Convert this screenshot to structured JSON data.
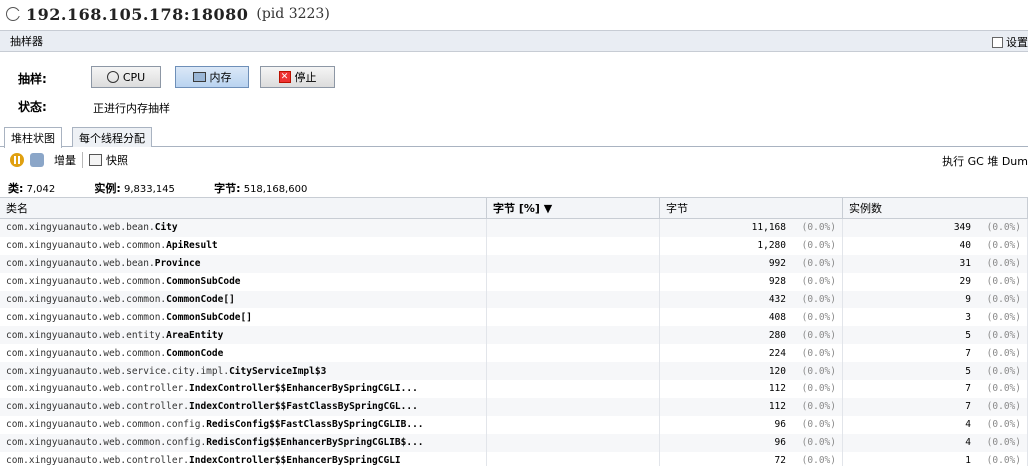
{
  "title": {
    "host": "192.168.105.178:18080",
    "pid": "(pid 3223)"
  },
  "sampler": {
    "label": "抽样器",
    "settings_label": "设置"
  },
  "sampling": {
    "label": "抽样:",
    "cpu_button": "CPU",
    "memory_button": "内存",
    "stop_button": "停止",
    "status_label": "状态:",
    "status_value": "正进行内存抽样"
  },
  "tabs": [
    {
      "label": "堆柱状图"
    },
    {
      "label": "每个线程分配"
    }
  ],
  "toolbar": {
    "delta_label": "增量",
    "snapshot_label": "快照",
    "right_text": "执行 GC  堆 Dum"
  },
  "stats": {
    "classes_label": "类:",
    "classes_value": "7,042",
    "instances_label": "实例:",
    "instances_value": "9,833,145",
    "bytes_label": "字节:",
    "bytes_value": "518,168,600"
  },
  "table": {
    "headers": {
      "name": "类名",
      "bytes_pct": "字节 [%] ▼",
      "bytes": "字节",
      "instances": "实例数"
    },
    "rows": [
      {
        "pkg": "com.xingyuanauto.web.bean.",
        "cls": "City",
        "bytes": "11,168",
        "bytes_pct": "(0.0%)",
        "instances": "349",
        "inst_pct": "(0.0%)"
      },
      {
        "pkg": "com.xingyuanauto.web.common.",
        "cls": "ApiResult",
        "bytes": "1,280",
        "bytes_pct": "(0.0%)",
        "instances": "40",
        "inst_pct": "(0.0%)"
      },
      {
        "pkg": "com.xingyuanauto.web.bean.",
        "cls": "Province",
        "bytes": "992",
        "bytes_pct": "(0.0%)",
        "instances": "31",
        "inst_pct": "(0.0%)"
      },
      {
        "pkg": "com.xingyuanauto.web.common.",
        "cls": "CommonSubCode",
        "bytes": "928",
        "bytes_pct": "(0.0%)",
        "instances": "29",
        "inst_pct": "(0.0%)"
      },
      {
        "pkg": "com.xingyuanauto.web.common.",
        "cls": "CommonCode[]",
        "bytes": "432",
        "bytes_pct": "(0.0%)",
        "instances": "9",
        "inst_pct": "(0.0%)"
      },
      {
        "pkg": "com.xingyuanauto.web.common.",
        "cls": "CommonSubCode[]",
        "bytes": "408",
        "bytes_pct": "(0.0%)",
        "instances": "3",
        "inst_pct": "(0.0%)"
      },
      {
        "pkg": "com.xingyuanauto.web.entity.",
        "cls": "AreaEntity",
        "bytes": "280",
        "bytes_pct": "(0.0%)",
        "instances": "5",
        "inst_pct": "(0.0%)"
      },
      {
        "pkg": "com.xingyuanauto.web.common.",
        "cls": "CommonCode",
        "bytes": "224",
        "bytes_pct": "(0.0%)",
        "instances": "7",
        "inst_pct": "(0.0%)"
      },
      {
        "pkg": "com.xingyuanauto.web.service.city.impl.",
        "cls": "CityServiceImpl$3",
        "bytes": "120",
        "bytes_pct": "(0.0%)",
        "instances": "5",
        "inst_pct": "(0.0%)"
      },
      {
        "pkg": "com.xingyuanauto.web.controller.",
        "cls": "IndexController$$EnhancerBySpringCGLI...",
        "bytes": "112",
        "bytes_pct": "(0.0%)",
        "instances": "7",
        "inst_pct": "(0.0%)"
      },
      {
        "pkg": "com.xingyuanauto.web.controller.",
        "cls": "IndexController$$FastClassBySpringCGL...",
        "bytes": "112",
        "bytes_pct": "(0.0%)",
        "instances": "7",
        "inst_pct": "(0.0%)"
      },
      {
        "pkg": "com.xingyuanauto.web.common.config.",
        "cls": "RedisConfig$$FastClassBySpringCGLIB...",
        "bytes": "96",
        "bytes_pct": "(0.0%)",
        "instances": "4",
        "inst_pct": "(0.0%)"
      },
      {
        "pkg": "com.xingyuanauto.web.common.config.",
        "cls": "RedisConfig$$EnhancerBySpringCGLIB$...",
        "bytes": "96",
        "bytes_pct": "(0.0%)",
        "instances": "4",
        "inst_pct": "(0.0%)"
      },
      {
        "pkg": "com.xingyuanauto.web.controller.",
        "cls": "IndexController$$EnhancerBySpringCGLI",
        "bytes": "72",
        "bytes_pct": "(0.0%)",
        "instances": "1",
        "inst_pct": "(0.0%)"
      }
    ]
  }
}
